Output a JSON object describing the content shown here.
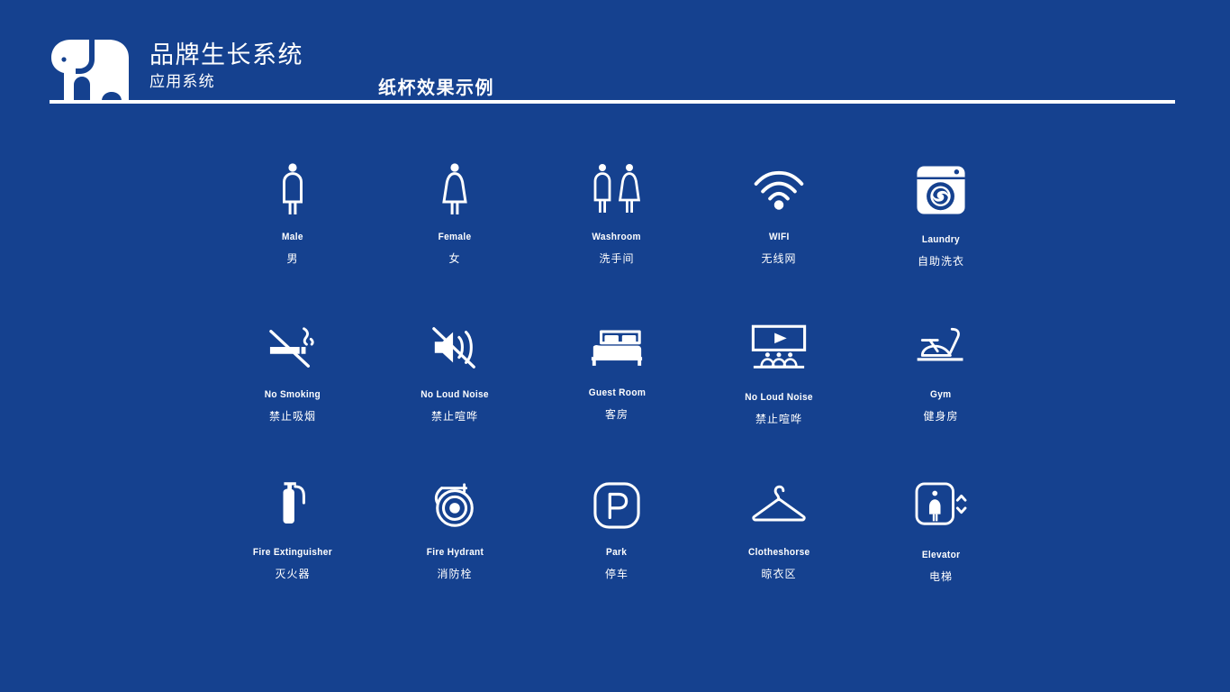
{
  "theme": {
    "background": "#15418f",
    "foreground": "#ffffff"
  },
  "header": {
    "logo_icon": "elephant-logo-icon",
    "title_main": "品牌生长系统",
    "title_sub": "应用系统",
    "section_caption": "纸杯效果示例"
  },
  "grid": {
    "rows": [
      [
        {
          "icon": "male-figure-icon",
          "en": "Male",
          "zh": "男"
        },
        {
          "icon": "female-figure-icon",
          "en": "Female",
          "zh": "女"
        },
        {
          "icon": "washroom-icon",
          "en": "Washroom",
          "zh": "洗手间"
        },
        {
          "icon": "wifi-icon",
          "en": "WIFI",
          "zh": "无线网"
        },
        {
          "icon": "washing-machine-icon",
          "en": "Laundry",
          "zh": "自助洗衣"
        }
      ],
      [
        {
          "icon": "no-smoking-icon",
          "en": "No Smoking",
          "zh": "禁止吸烟"
        },
        {
          "icon": "mute-speaker-icon",
          "en": "No Loud Noise",
          "zh": "禁止喧哗"
        },
        {
          "icon": "bed-icon",
          "en": "Guest Room",
          "zh": "客房"
        },
        {
          "icon": "cinema-screen-icon",
          "en": "No Loud Noise",
          "zh": "禁止喧哗"
        },
        {
          "icon": "exercise-bike-icon",
          "en": "Gym",
          "zh": "健身房"
        }
      ],
      [
        {
          "icon": "fire-extinguisher-icon",
          "en": "Fire Extinguisher",
          "zh": "灭火器"
        },
        {
          "icon": "hose-reel-icon",
          "en": "Fire Hydrant",
          "zh": "消防栓"
        },
        {
          "icon": "parking-p-icon",
          "en": "Park",
          "zh": "停车"
        },
        {
          "icon": "clothes-hanger-icon",
          "en": "Clotheshorse",
          "zh": "晾衣区"
        },
        {
          "icon": "elevator-icon",
          "en": "Elevator",
          "zh": "电梯"
        }
      ]
    ]
  }
}
